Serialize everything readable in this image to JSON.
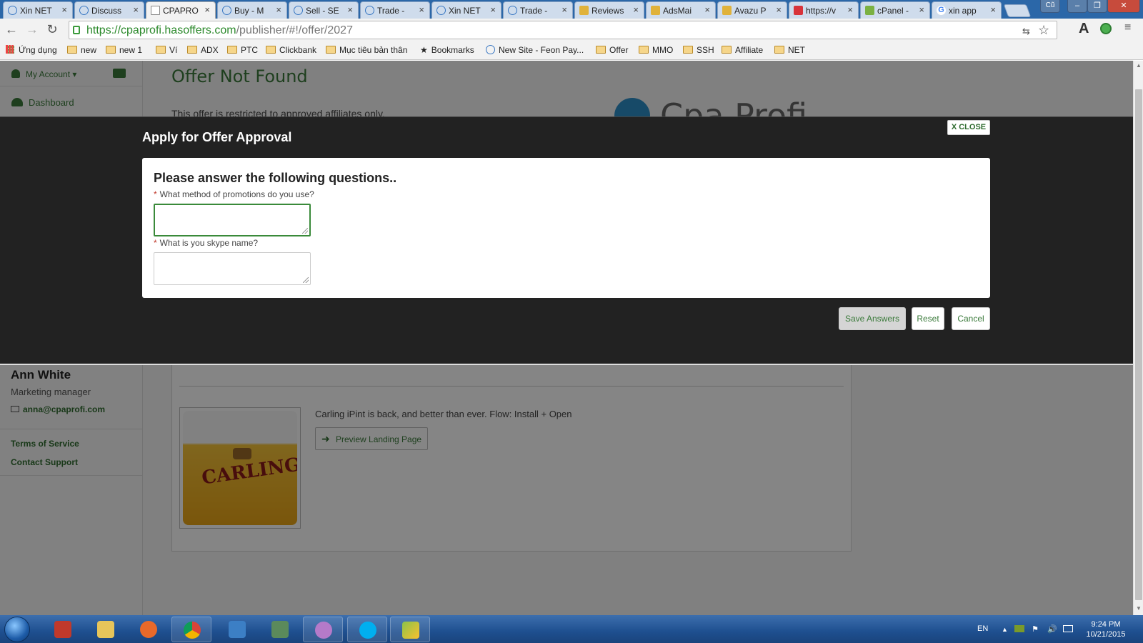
{
  "browser": {
    "tabs": [
      {
        "title": "Xin NET",
        "icon": "site-icon",
        "active": false
      },
      {
        "title": "Discuss",
        "icon": "site-icon",
        "active": false
      },
      {
        "title": "CPAPRO",
        "icon": "page-icon",
        "active": true
      },
      {
        "title": "Buy - M",
        "icon": "site-icon",
        "active": false
      },
      {
        "title": "Sell - SE",
        "icon": "site-icon",
        "active": false
      },
      {
        "title": "Trade -",
        "icon": "site-icon",
        "active": false
      },
      {
        "title": "Xin NET",
        "icon": "site-icon",
        "active": false
      },
      {
        "title": "Trade -",
        "icon": "site-icon",
        "active": false
      },
      {
        "title": "Reviews",
        "icon": "ads-icon",
        "active": false
      },
      {
        "title": "AdsMai",
        "icon": "ads-icon",
        "active": false
      },
      {
        "title": "Avazu P",
        "icon": "ads-icon",
        "active": false
      },
      {
        "title": "https://v",
        "icon": "red-icon",
        "active": false
      },
      {
        "title": "cPanel -",
        "icon": "cpanel-icon",
        "active": false
      },
      {
        "title": "xin app",
        "icon": "google-icon",
        "active": false
      }
    ],
    "user_button": "Cũ",
    "url_host": "https://cpaprofi.hasoffers.com",
    "url_path": "/publisher/#!/offer/2027",
    "bookmarks": [
      {
        "label": "Ứng dụng",
        "icon": "apps-icon"
      },
      {
        "label": "new",
        "icon": "folder-icon"
      },
      {
        "label": "new 1",
        "icon": "folder-icon"
      },
      {
        "label": "Ví",
        "icon": "folder-icon"
      },
      {
        "label": "ADX",
        "icon": "folder-icon"
      },
      {
        "label": "PTC",
        "icon": "folder-icon"
      },
      {
        "label": "Clickbank",
        "icon": "folder-icon"
      },
      {
        "label": "Mục tiêu bản thân",
        "icon": "folder-icon"
      },
      {
        "label": "Bookmarks",
        "icon": "star-icon"
      },
      {
        "label": "New Site - Feon Pay...",
        "icon": "site-icon"
      },
      {
        "label": "Offer",
        "icon": "folder-icon"
      },
      {
        "label": "MMO",
        "icon": "folder-icon"
      },
      {
        "label": "SSH",
        "icon": "folder-icon"
      },
      {
        "label": "Affiliate",
        "icon": "folder-icon"
      },
      {
        "label": "NET",
        "icon": "folder-icon"
      }
    ]
  },
  "sidebar": {
    "account_label": "My Account",
    "dashboard_label": "Dashboard",
    "manager": {
      "name": "Ann White",
      "role": "Marketing manager",
      "email": "anna@cpaprofi.com"
    },
    "links": [
      "Terms of Service",
      "Contact Support"
    ]
  },
  "main": {
    "title": "Offer Not Found",
    "restricted_text": "This offer is restricted to approved affiliates only.",
    "logo_text": "Cpa Profi",
    "offer": {
      "description": "Carling iPint is back, and better than ever. Flow: Install + Open",
      "preview_label": "Preview Landing Page",
      "thumbnail_text": "CARLING"
    }
  },
  "modal": {
    "title": "Apply for Offer Approval",
    "close_label": "X CLOSE",
    "heading": "Please answer the following questions..",
    "questions": [
      {
        "label": "What method of promotions do you use?",
        "value": ""
      },
      {
        "label": "What is you skype name?",
        "value": ""
      }
    ],
    "buttons": {
      "save": "Save Answers",
      "reset": "Reset",
      "cancel": "Cancel"
    }
  },
  "taskbar": {
    "language": "EN",
    "time": "9:24 PM",
    "date": "10/21/2015"
  },
  "colors": {
    "accent_green": "#3a7a3a",
    "modal_bg": "#222222",
    "taskbar_blue": "#1e4f8f"
  }
}
